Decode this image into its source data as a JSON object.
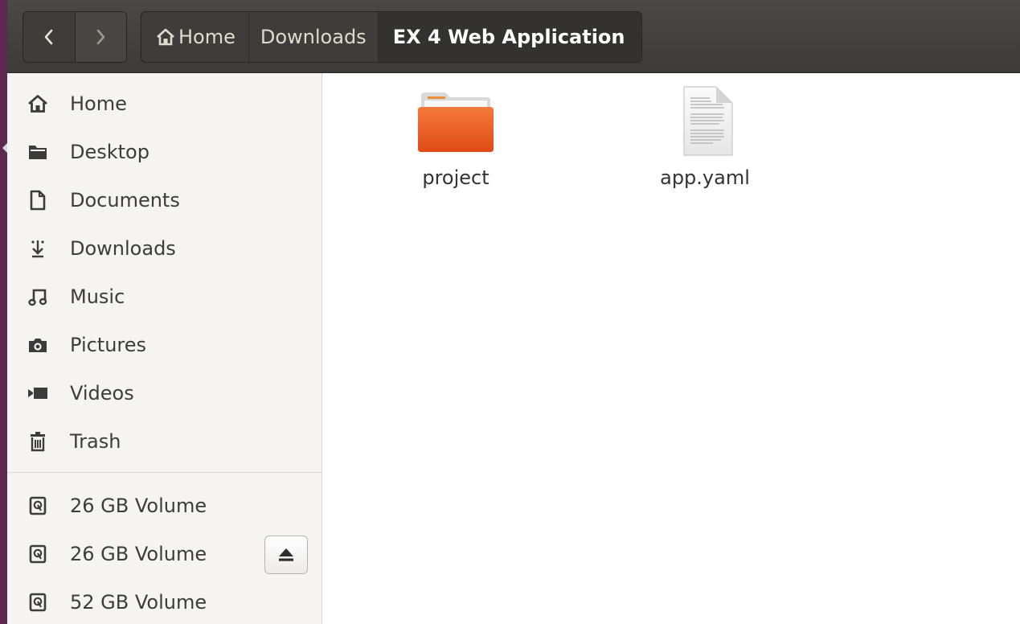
{
  "colors": {
    "headerbar": "#3c3b37",
    "launcher_edge": "#5e2750",
    "sidebar_bg": "#f5f4f3",
    "folder_orange": "#e95420"
  },
  "nav": {
    "back_icon": "chevron-left-icon",
    "forward_icon": "chevron-right-icon"
  },
  "breadcrumb": [
    {
      "label": "Home",
      "icon": "home-icon"
    },
    {
      "label": "Downloads"
    },
    {
      "label": "EX 4 Web Application"
    }
  ],
  "sidebar": {
    "places": [
      {
        "label": "Home",
        "icon": "home-icon"
      },
      {
        "label": "Desktop",
        "icon": "desktop-folder-icon"
      },
      {
        "label": "Documents",
        "icon": "document-icon"
      },
      {
        "label": "Downloads",
        "icon": "download-icon"
      },
      {
        "label": "Music",
        "icon": "music-icon"
      },
      {
        "label": "Pictures",
        "icon": "camera-icon"
      },
      {
        "label": "Videos",
        "icon": "video-icon"
      },
      {
        "label": "Trash",
        "icon": "trash-icon"
      }
    ],
    "devices": [
      {
        "label": "26 GB Volume",
        "icon": "drive-icon"
      },
      {
        "label": "26 GB Volume",
        "icon": "drive-icon",
        "eject_icon": "eject-icon"
      },
      {
        "label": "52 GB Volume",
        "icon": "drive-icon"
      }
    ]
  },
  "files": [
    {
      "name": "project",
      "type": "folder",
      "icon": "folder-icon"
    },
    {
      "name": "app.yaml",
      "type": "text",
      "icon": "text-file-icon"
    }
  ]
}
